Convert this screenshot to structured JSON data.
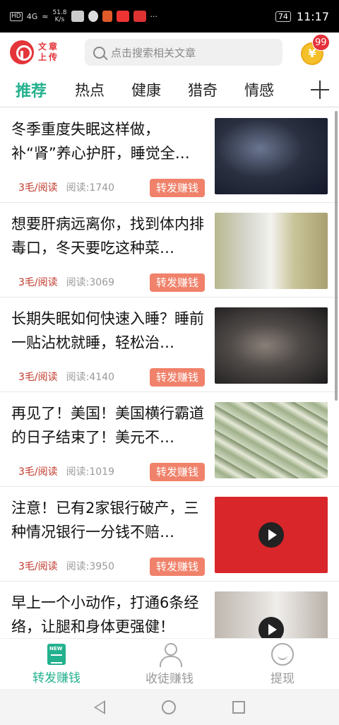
{
  "status_bar": {
    "hd": "HD",
    "signal": "4G",
    "speed_value": "51.8",
    "speed_unit": "K/s",
    "battery": "74",
    "time": "11:17",
    "more": "···"
  },
  "header": {
    "logo_text": "文章上传",
    "search_placeholder": "点击搜索相关文章",
    "coin_symbol": "¥",
    "coin_badge": "99"
  },
  "tabs": [
    "推荐",
    "热点",
    "健康",
    "猎奇",
    "情感"
  ],
  "articles": [
    {
      "title": "冬季重度失眠这样做，补“肾”养心护肝，睡觉全…",
      "price": "3毛/阅读",
      "reads": "阅读:1740",
      "button": "转发赚钱",
      "video": false
    },
    {
      "title": "想要肝病远离你，找到体内排毒口，冬天要吃这种菜…",
      "price": "3毛/阅读",
      "reads": "阅读:3069",
      "button": "转发赚钱",
      "video": false
    },
    {
      "title": "长期失眠如何快速入睡？睡前一贴沾枕就睡，轻松治…",
      "price": "3毛/阅读",
      "reads": "阅读:4140",
      "button": "转发赚钱",
      "video": false
    },
    {
      "title": "再见了！美国！美国横行霸道的日子结束了！美元不…",
      "price": "3毛/阅读",
      "reads": "阅读:1019",
      "button": "转发赚钱",
      "video": false
    },
    {
      "title": "注意！已有2家银行破产，三种情况银行一分钱不赔…",
      "price": "3毛/阅读",
      "reads": "阅读:3950",
      "button": "转发赚钱",
      "video": true
    },
    {
      "title": "早上一个小动作，打通6条经络，让腿和身体更强健！",
      "price": "",
      "reads": "",
      "button": "",
      "video": true
    }
  ],
  "bottom_nav": [
    {
      "label": "转发赚钱",
      "icon": "news-icon",
      "active": true
    },
    {
      "label": "收徒赚钱",
      "icon": "person-icon",
      "active": false
    },
    {
      "label": "提现",
      "icon": "smile-icon",
      "active": false
    }
  ],
  "colors": {
    "accent": "#23b18e",
    "brand_red": "#e3353a",
    "share_button": "#f0816a",
    "price_text": "#c0392b"
  }
}
